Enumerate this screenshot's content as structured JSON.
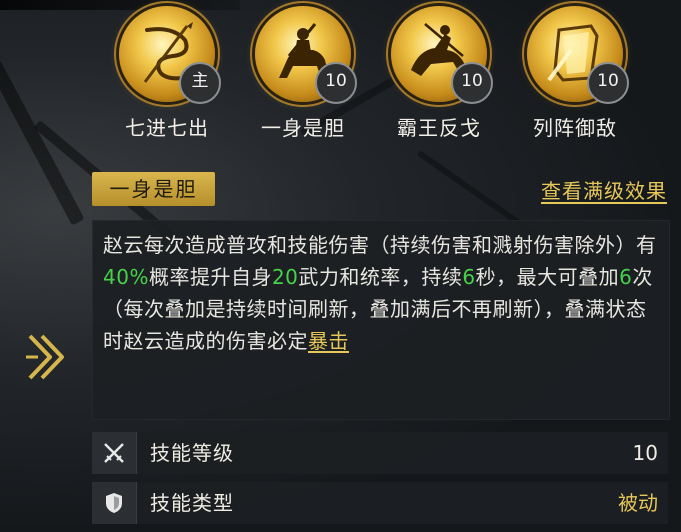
{
  "top_strip_text": "",
  "skills": [
    {
      "name": "七进七出",
      "badge": "主",
      "icon": "serpent-spear-icon"
    },
    {
      "name": "一身是胆",
      "badge": "10",
      "icon": "mounted-warrior-icon"
    },
    {
      "name": "霸王反戈",
      "badge": "10",
      "icon": "charging-horse-icon"
    },
    {
      "name": "列阵御敌",
      "badge": "10",
      "icon": "shield-formation-icon"
    }
  ],
  "selected_skill": {
    "name": "一身是胆"
  },
  "max_level_link": "查看满级效果",
  "description": {
    "p1": "赵云每次造成普攻和技能伤害（持续伤害和溅射伤害除外）有",
    "v1": "40%",
    "p2": "概率提升自身",
    "v2": "20",
    "p3": "武力和统率，持续",
    "v3": "6",
    "p4": "秒，最大可叠加",
    "v4": "6",
    "p5": "次（每次叠加是持续时间刷新，叠加满后不再刷新），叠满状态时赵云造成的伤害必定",
    "crit": "暴击"
  },
  "stats": [
    {
      "label": "技能等级",
      "value": "10",
      "icon": "crossed-swords-icon"
    },
    {
      "label": "技能类型",
      "value": "被动",
      "icon": "shield-icon"
    }
  ],
  "colors": {
    "gold": "#e6c75a",
    "highlight_green": "#46d24a",
    "panel_bg": "#1c2023"
  }
}
